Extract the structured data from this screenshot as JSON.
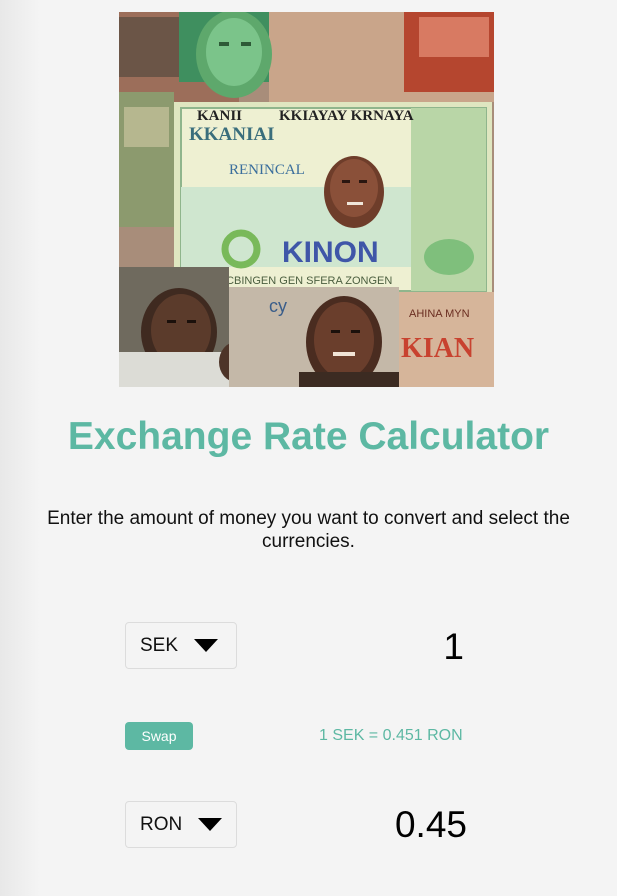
{
  "title": "Exchange Rate Calculator",
  "instructions": "Enter the amount of money you want to convert and select the currencies.",
  "from": {
    "currency": "SEK",
    "amount": "1"
  },
  "to": {
    "currency": "RON",
    "amount": "0.45"
  },
  "swap_label": "Swap",
  "rate_text": "1 SEK = 0.451 RON",
  "colors": {
    "accent": "#5db8a3",
    "background": "#f4f4f4"
  }
}
